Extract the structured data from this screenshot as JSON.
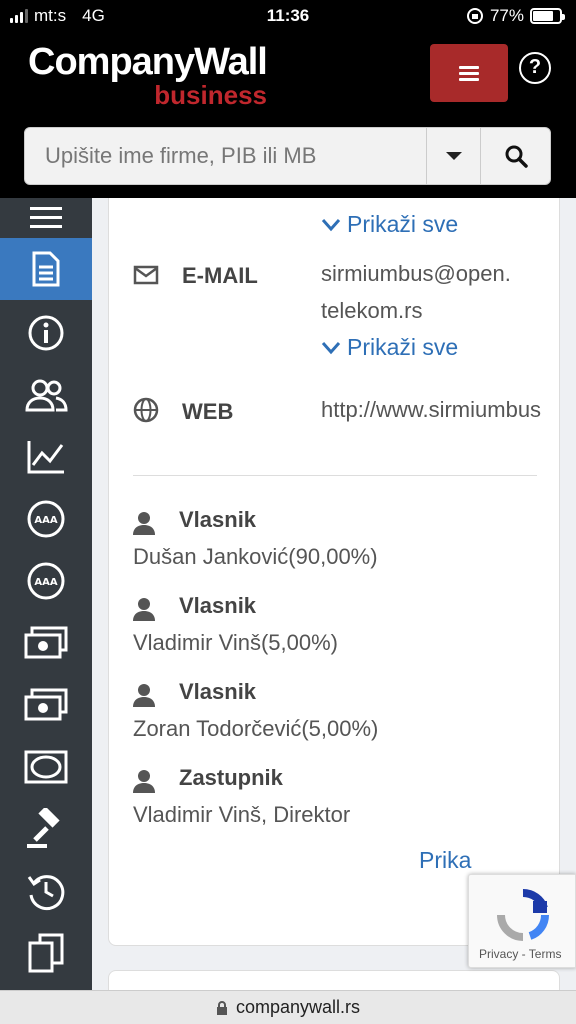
{
  "status": {
    "carrier": "mt:s",
    "network": "4G",
    "time": "11:36",
    "battery": "77%",
    "battery_level": 0.77
  },
  "logo": {
    "line1": "CompanyWall",
    "line2": "business"
  },
  "search": {
    "placeholder": "Upišite ime firme, PIB ili MB"
  },
  "contact": {
    "show_all_top": "Prikaži sve",
    "email_label": "E-MAIL",
    "email_value_line1": "sirmiumbus@open.",
    "email_value_line2": "telekom.rs",
    "show_all_email": "Prikaži sve",
    "web_label": "WEB",
    "web_value": "http://www.sirmiumbus"
  },
  "people": [
    {
      "role": "Vlasnik",
      "name": "Dušan Janković(90,00%)"
    },
    {
      "role": "Vlasnik",
      "name": "Vladimir Vinš(5,00%)"
    },
    {
      "role": "Vlasnik",
      "name": "Zoran Todorčević(5,00%)"
    },
    {
      "role": "Zastupnik",
      "name": "Vladimir Vinš, Direktor"
    }
  ],
  "show_more": "Prika",
  "captcha": {
    "terms": "Privacy - Terms"
  },
  "url": "companywall.rs",
  "colors": {
    "accent": "#3a79bf",
    "brand": "#a82a2a",
    "sidebar": "#343a40",
    "link": "#2e6fb6"
  }
}
